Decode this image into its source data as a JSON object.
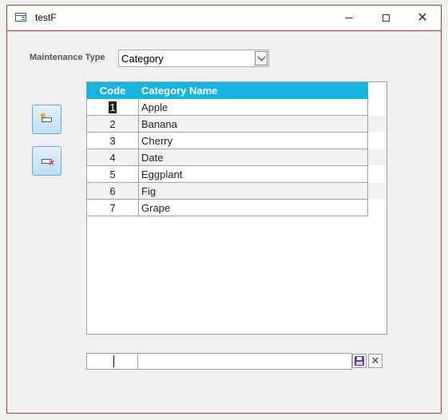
{
  "window": {
    "title": "testF",
    "close_symbol": "✕"
  },
  "form": {
    "maintenance_type_label": "Maintenance Type",
    "maintenance_type_value": "Category"
  },
  "grid": {
    "columns": [
      "Code",
      "Category Name"
    ],
    "rows": [
      {
        "code": "1",
        "name": "Apple"
      },
      {
        "code": "2",
        "name": "Banana"
      },
      {
        "code": "3",
        "name": "Cherry"
      },
      {
        "code": "4",
        "name": "Date"
      },
      {
        "code": "5",
        "name": "Eggplant"
      },
      {
        "code": "6",
        "name": "Fig"
      },
      {
        "code": "7",
        "name": "Grape"
      }
    ],
    "header_color": "#18b4e0"
  },
  "editor": {
    "code_value": "",
    "name_value": "",
    "cancel_symbol": "✕"
  },
  "icons": {
    "app": "form-icon",
    "add": "add-row-icon",
    "delete": "delete-row-icon",
    "save": "save-disk-icon",
    "cancel": "cancel-icon"
  }
}
